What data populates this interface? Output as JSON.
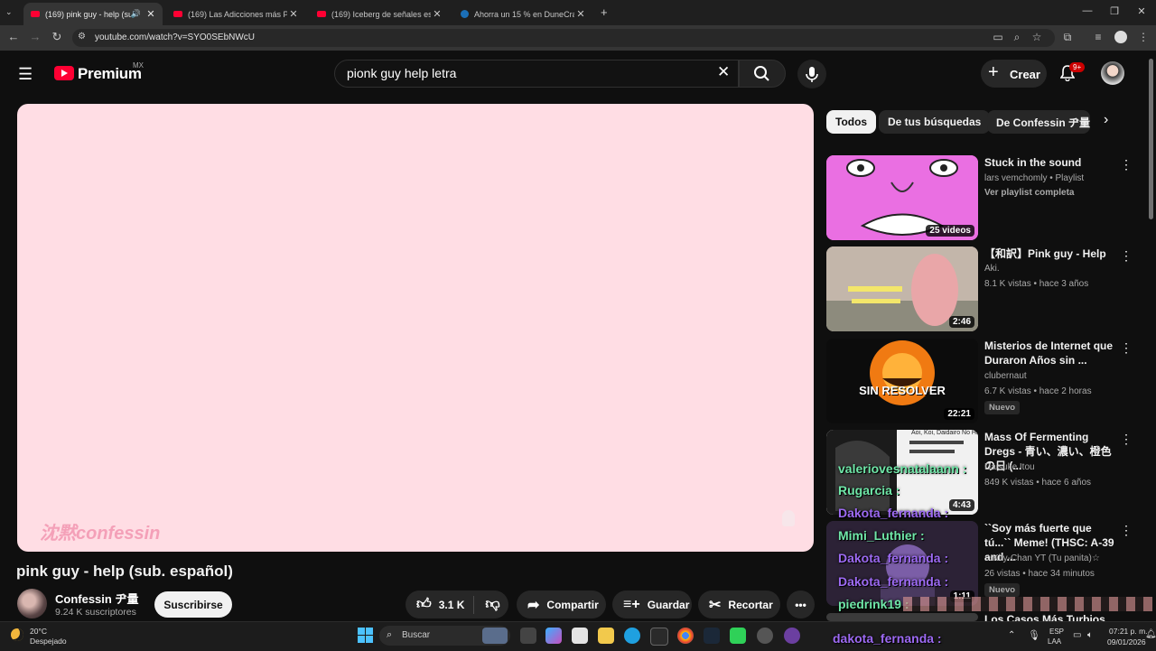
{
  "browser": {
    "tabs": [
      {
        "title": "(169) pink guy - help (sub.",
        "active": true
      },
      {
        "title": "(169) Las Adicciones más Pertu",
        "active": false
      },
      {
        "title": "(169) Iceberg de señales escala",
        "active": false
      },
      {
        "title": "Ahorra un 15 % en DuneCrawl",
        "active": false
      }
    ],
    "url": "youtube.com/watch?v=SYO0SEbNWcU"
  },
  "youtube": {
    "brand": "Premium",
    "region": "MX",
    "search_value": "pionk guy help letra",
    "create_label": "Crear",
    "notif_badge": "9+"
  },
  "video": {
    "watermark": "沈黙confessin",
    "title": "pink guy - help (sub. español)",
    "channel": "Confessin ヂ量",
    "subscribers": "9.24 K suscriptores",
    "subscribe_label": "Suscribirse",
    "likes": "3.1 K",
    "share_label": "Compartir",
    "save_label": "Guardar",
    "clip_label": "Recortar"
  },
  "chips": [
    "Todos",
    "De tus búsquedas",
    "De Confessin ヂ量"
  ],
  "recommendations": [
    {
      "title": "Stuck in the sound",
      "channel": "lars vemchomly • Playlist",
      "meta": "Ver playlist completa",
      "badge": "25 videos",
      "nuevo": ""
    },
    {
      "title": "【和訳】Pink guy - Help",
      "channel": "Aki.",
      "meta": "8.1 K vistas • hace 3 años",
      "badge": "2:46",
      "nuevo": ""
    },
    {
      "title": "Misterios de Internet que Duraron Años sin ...",
      "channel": "clubernaut",
      "meta": "6.7 K vistas • hace 2 horas",
      "badge": "22:21",
      "nuevo": "Nuevo",
      "thumb_text": "SIN RESOLVER"
    },
    {
      "title": "Mass Of Fermenting Dregs - 青い、濃い、橙色の日 (...",
      "channel": "Daisuke Itou",
      "meta": "849 K vistas • hace 6 años",
      "badge": "4:43",
      "nuevo": "",
      "thumb_text": "Aoi, Koi, Daidairo No Hi"
    },
    {
      "title": "``Soy más fuerte que tú...`` Meme! (THSC: A-39 and ...",
      "channel": "☆Kity-Chan YT (Tu panita)☆",
      "meta": "26 vistas • hace 34 minutos",
      "badge": "1:11",
      "nuevo": "Nuevo"
    },
    {
      "title": "Los Casos Más Turbios de ...",
      "channel": "",
      "meta": "",
      "badge": "",
      "nuevo": ""
    }
  ],
  "chat_overlay": [
    {
      "user": "valeriovesnatalaann :",
      "color": "green"
    },
    {
      "user": "Rugarcia :",
      "color": "green"
    },
    {
      "user": "Dakota_fernanda :",
      "color": "purple"
    },
    {
      "user": "Mimi_Luthier :",
      "color": "green"
    },
    {
      "user": "Dakota_fernanda :",
      "color": "purple"
    },
    {
      "user": "Dakota_fernanda :",
      "color": "purple"
    },
    {
      "user": "piedrink19 :",
      "color": "green"
    },
    {
      "user": "dakota_fernanda :",
      "color": "purple"
    }
  ],
  "taskbar": {
    "weather_temp": "20°C",
    "weather_cond": "Despejado",
    "search_label": "Buscar",
    "lang1": "ESP",
    "lang2": "LAA",
    "time": "07:21 p. m.",
    "date": "09/01/2026"
  }
}
